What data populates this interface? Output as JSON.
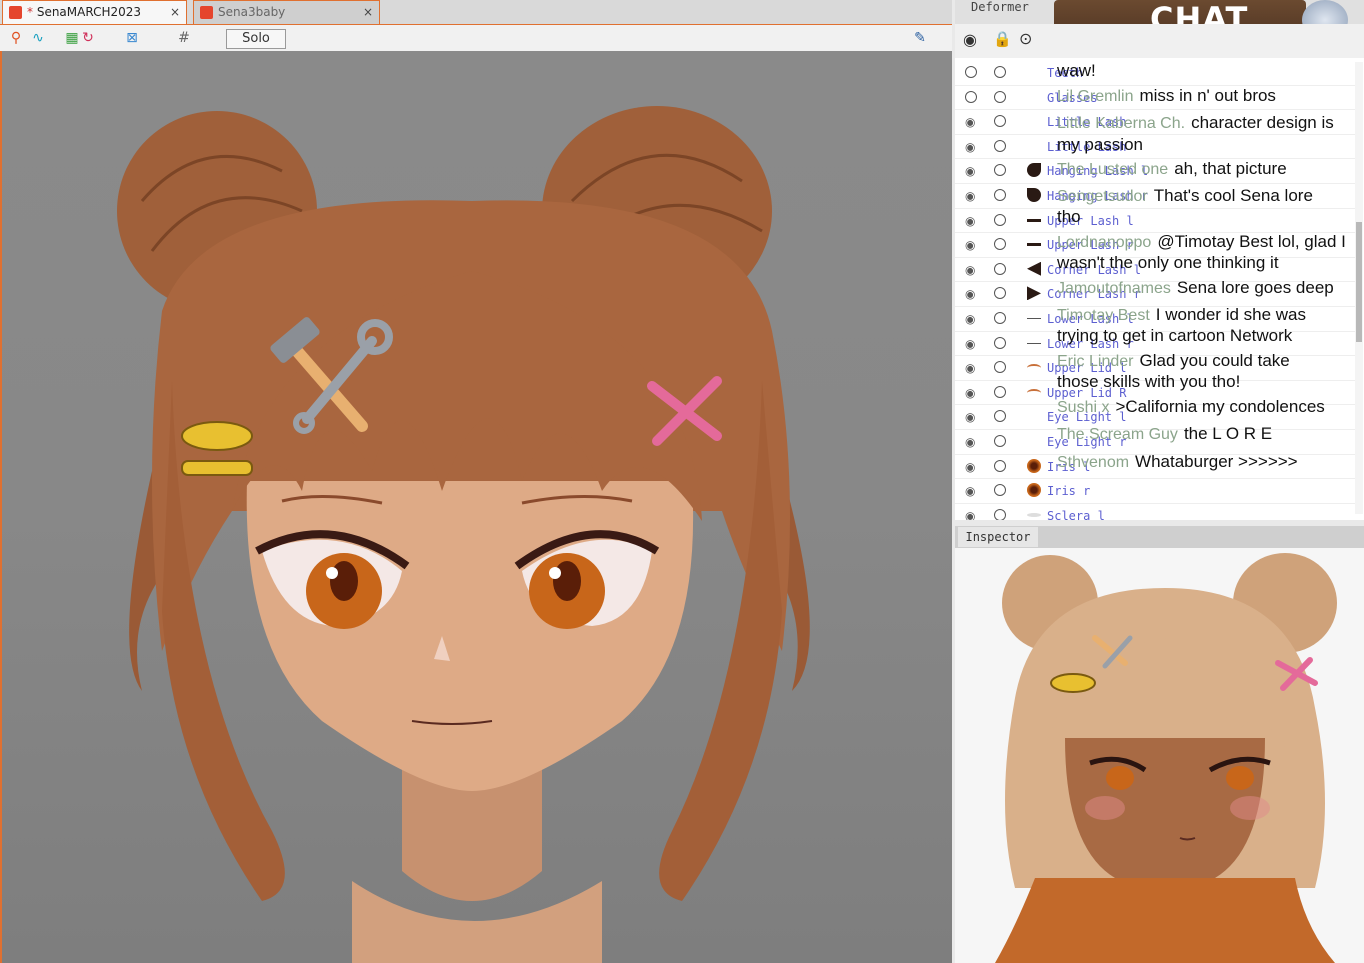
{
  "tabs": [
    {
      "label": "SenaMARCH2023",
      "modified": true,
      "close": "×"
    },
    {
      "label": "Sena3baby",
      "close": "×"
    }
  ],
  "toolbar": {
    "solo_label": "Solo"
  },
  "deformer": {
    "title": "Deformer",
    "rows": [
      {
        "name": "Teeth"
      },
      {
        "name": "Glasses"
      },
      {
        "name": "Little Lash"
      },
      {
        "name": "Little Lash"
      },
      {
        "name": "Hanging Lash l"
      },
      {
        "name": "Hanging Lash r"
      },
      {
        "name": "Upper Lash l"
      },
      {
        "name": "Upper Lash r"
      },
      {
        "name": "Corner Lash l"
      },
      {
        "name": "Corner Lash r"
      },
      {
        "name": "Lower Lash l"
      },
      {
        "name": "Lower Lash r"
      },
      {
        "name": "Upper Lid l"
      },
      {
        "name": "Upper Lid R"
      },
      {
        "name": "Eye Light l"
      },
      {
        "name": "Eye Light r"
      },
      {
        "name": "Iris l"
      },
      {
        "name": "Iris r"
      },
      {
        "name": "Sclera l"
      }
    ]
  },
  "chat": {
    "title": "CHAT",
    "messages": [
      {
        "name": "",
        "text": "waw!"
      },
      {
        "name": "Lil Gremlin",
        "text": "miss in n' out bros"
      },
      {
        "name": "Little Kaberna Ch.",
        "text": "character design is"
      },
      {
        "name": "",
        "text": "my passion"
      },
      {
        "name": "The Lusted one",
        "text": "ah, that picture"
      },
      {
        "name": "Sengetsudor",
        "text": "That's cool Sena lore"
      },
      {
        "name": "",
        "text": "tho"
      },
      {
        "name": "Lordnanoppo",
        "text": "@Timotay Best lol, glad I"
      },
      {
        "name": "",
        "text": "wasn't the only one thinking it"
      },
      {
        "name": "Jamoutofnames",
        "text": "Sena lore goes deep"
      },
      {
        "name": "Timotay Best",
        "text": "I wonder id she was"
      },
      {
        "name": "",
        "text": "trying to get in cartoon Network"
      },
      {
        "name": "Eric Linder",
        "text": "Glad you could take"
      },
      {
        "name": "",
        "text": "those skills with you tho!"
      },
      {
        "name": "Sushi x",
        "text": ">California my condolences"
      },
      {
        "name": "The Scream Guy",
        "text": "the L O R E"
      },
      {
        "name": "Sthvenom",
        "text": "Whataburger >>>>>>"
      }
    ]
  },
  "inspector": {
    "label": "Inspector"
  },
  "colors": {
    "accent": "#e07030",
    "layer_name": "#5c5fd0",
    "canvas_bg": "#888888"
  }
}
